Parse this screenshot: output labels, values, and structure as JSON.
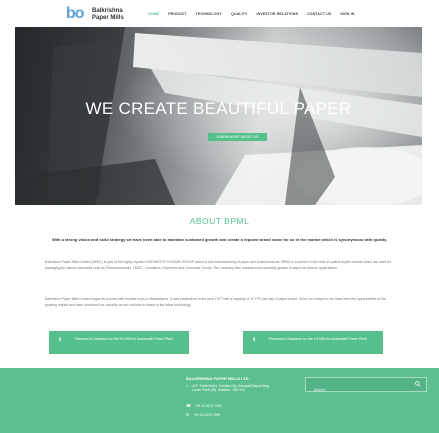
{
  "header": {
    "logo_mark": "bo",
    "logo_line1": "Balkrishna",
    "logo_line2": "Paper Mills",
    "nav": [
      {
        "label": "HOME",
        "active": true
      },
      {
        "label": "PRODUCT",
        "active": false
      },
      {
        "label": "TECHNOLOGY",
        "active": false
      },
      {
        "label": "QUALITY",
        "active": false
      },
      {
        "label": "INVESTOR RELATIONS",
        "active": false
      },
      {
        "label": "CONTACT US",
        "active": false
      },
      {
        "label": "SIGN IN",
        "active": false
      }
    ]
  },
  "hero": {
    "title": "WE CREATE BEAUTIFUL PAPER",
    "button_label": "LEARN MORE ABOUT US"
  },
  "about": {
    "title": "ABOUT BPML",
    "lead": "With a strong vision and solid strategy we have been able to maintain sustained growth and create a reputed brand name for us in the market which is synonymous with quality.",
    "paragraphs": [
      "Balkrishna Paper Mills Limited (BPML) is part of the highly reputed SIDDHARTH PODDAR GROUP which is into manufacturing of paper and board products. BPML is a pioneer in the field of coated duplex boards which are used for packaging by various industries such as Pharmaceuticals, FMCG, Cosmetics, Garments and Consumer Goods. The company also manufactures specialty grades of paper for diverse applications.",
      "Balkrishna Paper Mills Limited began its journey with humble roots in Maharashtra. It was established in the year 1977 with a capacity of 12 TPD per day of paper board. Since our inception, we have seen the opportunities of the growing market and have increased our capacity as we continue to invest in the latest technology."
    ]
  },
  "cards": [
    {
      "label": "Permanent Clearance for the 3.5 MW for Ambernath Power Plant"
    },
    {
      "label": "Permanent Clearance for the 3.5 MW for Ambernath Power Plant"
    }
  ],
  "footer": {
    "company": "BALKRISHNA PAPER MILLS LTD",
    "address": "A/7, Trade World, Kamala City, Senapati Bapat Marg, Lower Parel (W), Mumbai - 400 013",
    "phone": "+91 22 6120 7900",
    "fax": "+91 22 6120 7999",
    "search_placeholder": "Search"
  },
  "colors": {
    "accent": "#56c08d",
    "footer": "#5cbf8e"
  }
}
